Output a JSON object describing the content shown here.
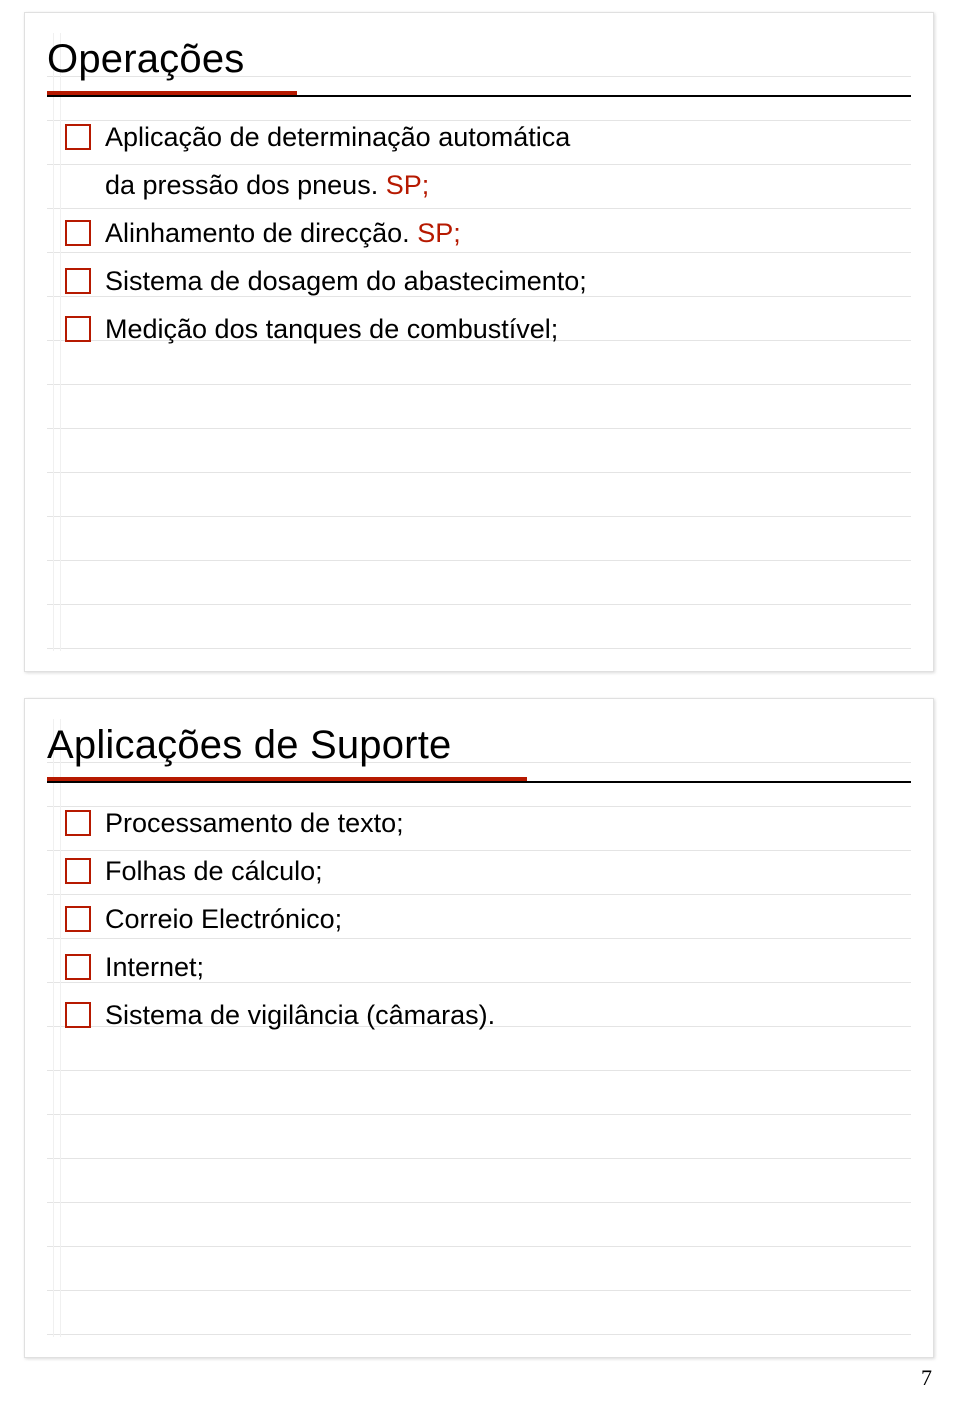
{
  "slide1": {
    "title": "Operações",
    "items": [
      {
        "line1": "Aplicação de determinação automática",
        "line2": "da pressão dos pneus. ",
        "sp1": "SP;"
      },
      {
        "line1": "Alinhamento de direcção. ",
        "sp1": "SP;"
      },
      {
        "line1": "Sistema de dosagem do abastecimento;"
      },
      {
        "line1": "Medição dos tanques de combustível;"
      }
    ]
  },
  "slide2": {
    "title": "Aplicações de Suporte",
    "items": [
      {
        "line1": "Processamento de texto;"
      },
      {
        "line1": "Folhas de cálculo;"
      },
      {
        "line1": "Correio Electrónico;"
      },
      {
        "line1": "Internet;"
      },
      {
        "line1": "Sistema de vigilância (câmaras)."
      }
    ]
  },
  "page_number": "7"
}
